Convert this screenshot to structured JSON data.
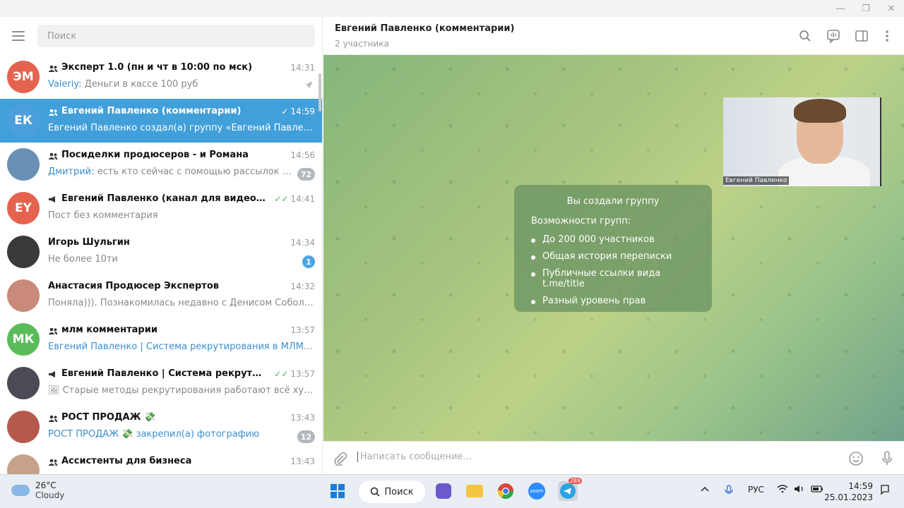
{
  "window": {
    "minimize": "—",
    "maximize": "❐",
    "close": "✕"
  },
  "sidebar": {
    "search_placeholder": "Поиск",
    "chats": [
      {
        "initials": "ЭМ",
        "avatar_color": "#e5634e",
        "title": "Эксперт 1.0 (пн и чт в 10:00 по мск)",
        "time": "14:31",
        "sender": "Valeriy:",
        "message": " Деньги в кассе 100 руб",
        "pinned": true,
        "group": true
      },
      {
        "initials": "ЕК",
        "avatar_color": "#4a9fdc",
        "title": "Евгений Павленко (комментарии)",
        "time": "14:59",
        "sender": "",
        "message": "Евгений Павленко создал(а) группу «Евгений Павленко (ко...",
        "active": true,
        "group": true
      },
      {
        "initials": "",
        "avatar_color": "#6a8fb5",
        "title": "Посиделки продюсеров - и Романа",
        "time": "14:56",
        "sender": "Дмитрий:",
        "message": " есть кто сейчас с помощью рассылок прода...",
        "badge": "72",
        "group": true
      },
      {
        "initials": "EY",
        "avatar_color": "#e5634e",
        "title": "Евгений Павленко (канал для видео в YouTub...",
        "time": "14:41",
        "sender": "",
        "message": "Пост без комментария",
        "channel": true
      },
      {
        "initials": "",
        "avatar_color": "#3a3a3a",
        "title": "Игорь Шульгин",
        "time": "14:34",
        "sender": "",
        "message": "Не более 10ти",
        "badge": "1"
      },
      {
        "initials": "",
        "avatar_color": "#c98a7a",
        "title": "Анастасия Продюсер Экспертов",
        "time": "14:32",
        "sender": "",
        "message": "Поняла))). Познакомилась недавно с Денисом Соболевым, ..."
      },
      {
        "initials": "МК",
        "avatar_color": "#5bbb5b",
        "title": "млм комментарии",
        "time": "13:57",
        "sender": "Евгений Павленко | Система рекрутирования в МЛМ:",
        "message": " 🖼 ...",
        "group": true
      },
      {
        "initials": "",
        "avatar_color": "#4b4b55",
        "title": "Евгений Павленко | Система рекрутировани...",
        "time": "13:57",
        "sender": "",
        "message": "🖼 Старые методы рекрутирования работают всё хуже, и ...",
        "channel": true
      },
      {
        "initials": "",
        "avatar_color": "#b55a4a",
        "title": "РОСТ ПРОДАЖ 💸",
        "time": "13:43",
        "sender": "РОСТ ПРОДАЖ 💸 закрепил(а) фотографию",
        "message": "",
        "badge": "12",
        "group": true
      },
      {
        "initials": "",
        "avatar_color": "#c7a28a",
        "title": "Ассистенты для бизнеса",
        "time": "13:43",
        "sender": "",
        "message": "",
        "group": true
      }
    ]
  },
  "chat": {
    "title": "Евгений Павленко (комментарии)",
    "subtitle": "2 участника",
    "service": {
      "title": "Вы создали группу",
      "subtitle": "Возможности групп:",
      "features": [
        "До 200 000 участников",
        "Общая история переписки",
        "Публичные ссылки вида t.me/title",
        "Разный уровень прав"
      ]
    },
    "video_name": "Евгений Павленко",
    "composer_placeholder": "Написать сообщение..."
  },
  "taskbar": {
    "temperature": "26°C",
    "weather": "Cloudy",
    "search": "Поиск",
    "telegram_badge": "289",
    "language": "РУС",
    "time": "14:59",
    "date": "25.01.2023"
  }
}
